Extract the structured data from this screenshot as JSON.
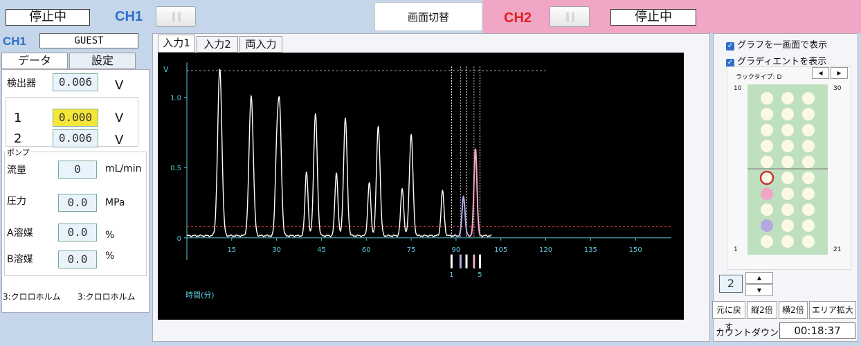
{
  "header": {
    "ch1_status": "停止中",
    "ch1_label": "CH1",
    "switch_label": "画面切替",
    "ch2_label": "CH2",
    "ch2_status": "停止中"
  },
  "left": {
    "ch_label": "CH1",
    "user": "GUEST",
    "tabs": [
      "データ",
      "設定"
    ],
    "detector_label": "検出器",
    "detector_value": "0.006",
    "detector_unit": "V",
    "ch_rows": [
      {
        "num": "1",
        "value": "0.000",
        "unit": "V",
        "highlight": "#f5e63a"
      },
      {
        "num": "2",
        "value": "0.006",
        "unit": "V"
      }
    ],
    "pump_title": "ポンプ",
    "pump_rows": [
      {
        "label": "流量",
        "value": "0",
        "unit": "mL/min"
      },
      {
        "label": "圧力",
        "value": "0.0",
        "unit": "MPa"
      },
      {
        "label": "A溶媒",
        "value": "0.0",
        "unit": "%"
      },
      {
        "label": "B溶媒",
        "value": "0.0",
        "unit": "%"
      }
    ],
    "solvent_a": "3:クロロホルム",
    "solvent_b": "3:クロロホルム"
  },
  "graph_tabs": [
    "入力1",
    "入力2",
    "両入力"
  ],
  "chart_data": {
    "type": "line",
    "ylabel": "V",
    "xlabel": "時間(分)",
    "y_ticks": [
      "0",
      "0.5",
      "1.0"
    ],
    "x_ticks": [
      "15",
      "30",
      "45",
      "60",
      "75",
      "90",
      "105",
      "120",
      "135",
      "150"
    ],
    "xlim": [
      0,
      162
    ],
    "ylim": [
      -0.08,
      1.22
    ],
    "threshold": 0.08,
    "peaks": [
      {
        "t": 11,
        "h": 1.19,
        "w": 0.7
      },
      {
        "t": 21.5,
        "h": 1.0,
        "w": 0.7
      },
      {
        "t": 31,
        "h": 0.9,
        "w": 0.6
      },
      {
        "t": 30,
        "h": 0.5,
        "w": 0.5
      },
      {
        "t": 43,
        "h": 0.87,
        "w": 0.6
      },
      {
        "t": 40,
        "h": 0.46,
        "w": 0.5
      },
      {
        "t": 53,
        "h": 0.84,
        "w": 0.6
      },
      {
        "t": 50,
        "h": 0.45,
        "w": 0.5
      },
      {
        "t": 64,
        "h": 0.78,
        "w": 0.6
      },
      {
        "t": 61,
        "h": 0.38,
        "w": 0.5
      },
      {
        "t": 75,
        "h": 0.72,
        "w": 0.6
      },
      {
        "t": 72,
        "h": 0.34,
        "w": 0.5
      },
      {
        "t": 85.5,
        "h": 0.32,
        "w": 0.5
      },
      {
        "t": 92.5,
        "h": 0.28,
        "w": 0.5
      },
      {
        "t": 96.5,
        "h": 0.62,
        "w": 0.5
      }
    ],
    "fractions": [
      {
        "t": 88.5,
        "color": "#ffffff"
      },
      {
        "t": 91.5,
        "color": "#b9a8e6"
      },
      {
        "t": 93.5,
        "color": "#ffffff"
      },
      {
        "t": 96,
        "color": "#f0a6c4"
      },
      {
        "t": 98,
        "color": "#ffffff"
      }
    ],
    "fraction_labels": [
      "1",
      "5"
    ],
    "grid": false
  },
  "right": {
    "opt1": "グラフを一画面で表示",
    "opt2": "グラディエントを表示",
    "rack_label": "ラックタイプ: D",
    "rack_nums": {
      "tl": "10",
      "tr": "30",
      "bl": "1",
      "br": "21"
    },
    "rack_colors": {
      "bg": "#bfe0bf",
      "well": "#fbf8e6",
      "current": "#c83232",
      "pink": "#f0a6c4",
      "purple": "#b3a9e0"
    },
    "page": "2",
    "buttons": [
      "元に戻す",
      "縦2倍",
      "横2倍",
      "エリア拡大"
    ],
    "countdown_label": "カウントダウン",
    "countdown_value": "00:18:37"
  }
}
